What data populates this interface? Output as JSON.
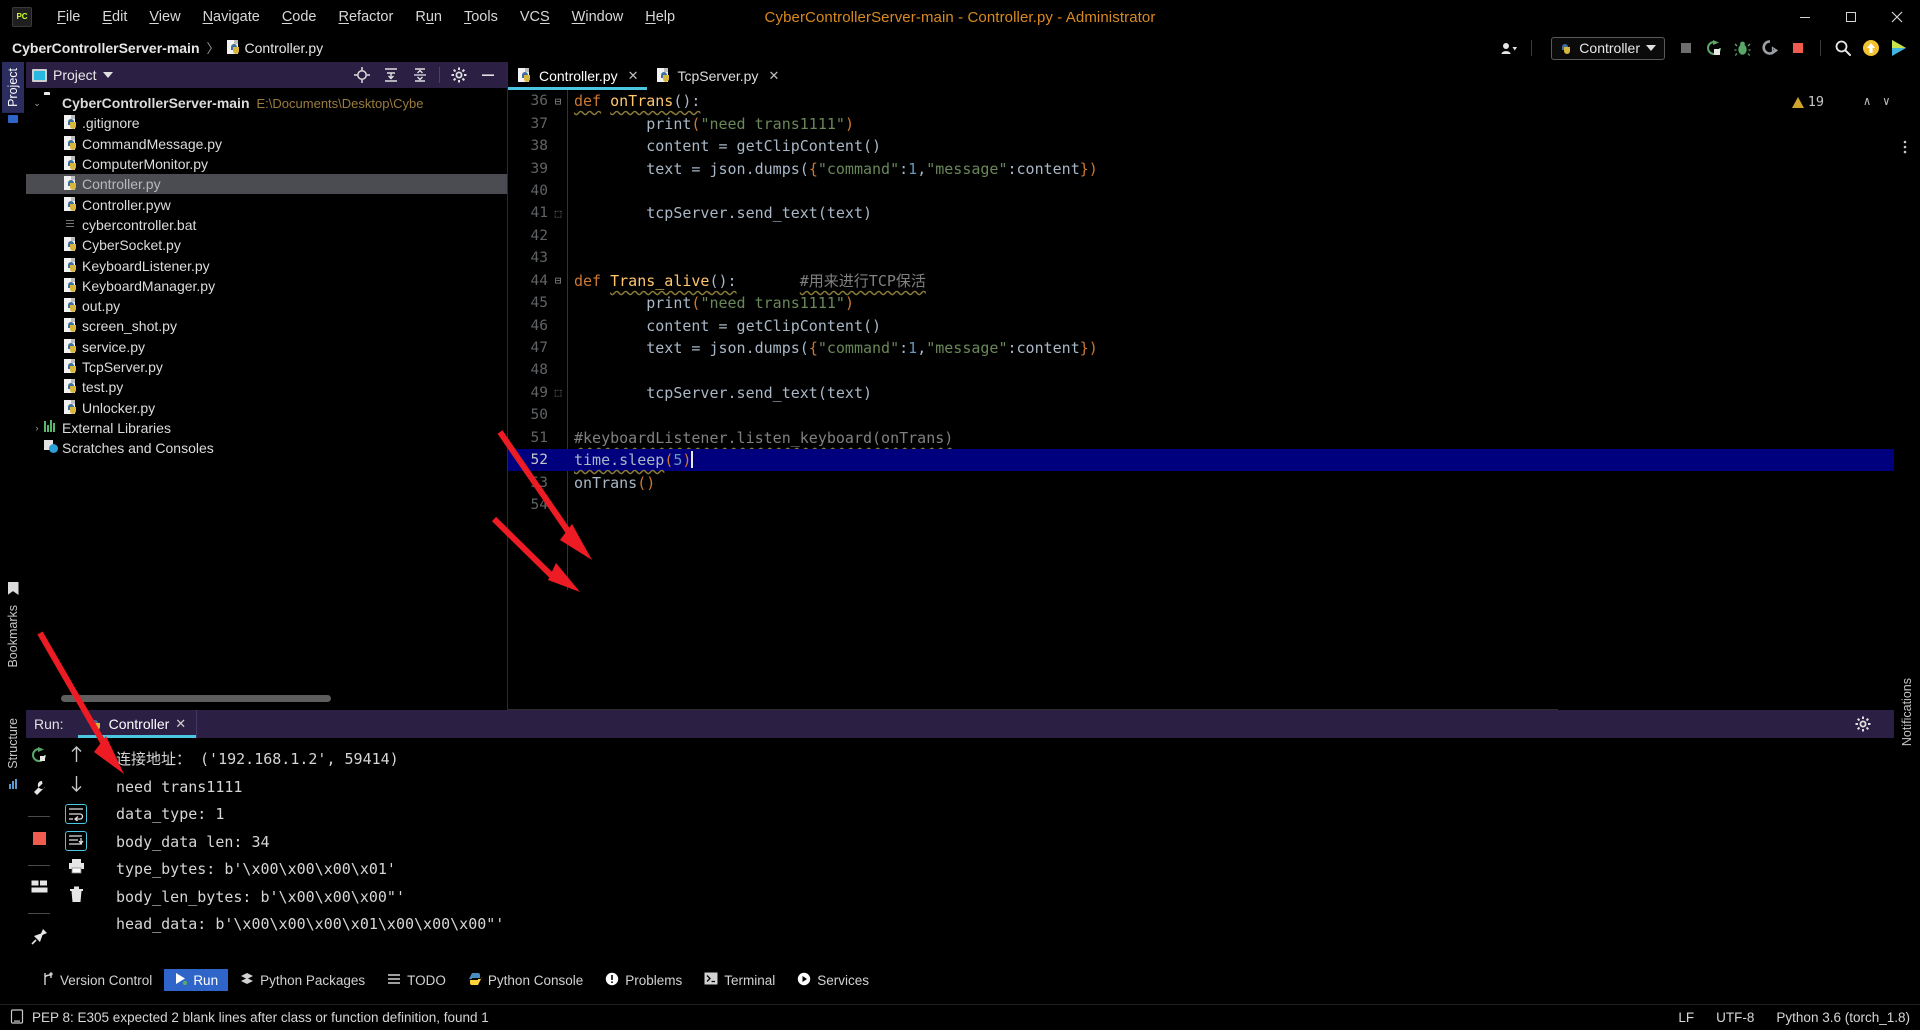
{
  "window": {
    "title": "CyberControllerServer-main - Controller.py - Administrator",
    "logo": "pycharm-logo",
    "minimize": "─",
    "maximize": "❐",
    "close": "✕"
  },
  "menu": [
    {
      "label": "File",
      "mnemonic": "F"
    },
    {
      "label": "Edit",
      "mnemonic": "E"
    },
    {
      "label": "View",
      "mnemonic": "V"
    },
    {
      "label": "Navigate",
      "mnemonic": "N"
    },
    {
      "label": "Code",
      "mnemonic": "C"
    },
    {
      "label": "Refactor",
      "mnemonic": "R"
    },
    {
      "label": "Run",
      "mnemonic": "u"
    },
    {
      "label": "Tools",
      "mnemonic": "T"
    },
    {
      "label": "VCS",
      "mnemonic": "S"
    },
    {
      "label": "Window",
      "mnemonic": "W"
    },
    {
      "label": "Help",
      "mnemonic": "H"
    }
  ],
  "navbar": {
    "breadcrumbs": [
      "CyberControllerServer-main",
      "Controller.py"
    ],
    "separator": "〉",
    "run_config": "Controller",
    "dropdown_caret": "▼",
    "account_caret": "▼"
  },
  "left_strip": [
    {
      "label": "Project",
      "active": true
    },
    {
      "label": "Bookmarks",
      "active": false
    },
    {
      "label": "Structure",
      "active": false
    }
  ],
  "right_strip": [
    {
      "label": "Notifications",
      "active": false
    }
  ],
  "project": {
    "title": "Project",
    "dropdown_caret": "▼",
    "header_icons": [
      "locate-icon",
      "expand-all-icon",
      "collapse-all-icon",
      "gear-icon",
      "hide-icon"
    ],
    "tree": [
      {
        "label": "CyberControllerServer-main",
        "path": "E:\\Documents\\Desktop\\Cybe",
        "icon": "folder-icon",
        "indent": 0,
        "chevron": "⌄",
        "bold": true,
        "selected": false
      },
      {
        "label": ".gitignore",
        "path": "",
        "icon": "python-file-icon",
        "indent": 1,
        "chevron": "",
        "bold": false,
        "selected": false
      },
      {
        "label": "CommandMessage.py",
        "path": "",
        "icon": "python-file-icon",
        "indent": 1,
        "chevron": "",
        "bold": false,
        "selected": false
      },
      {
        "label": "ComputerMonitor.py",
        "path": "",
        "icon": "python-file-icon",
        "indent": 1,
        "chevron": "",
        "bold": false,
        "selected": false
      },
      {
        "label": "Controller.py",
        "path": "",
        "icon": "python-file-icon",
        "indent": 1,
        "chevron": "",
        "bold": false,
        "selected": true
      },
      {
        "label": "Controller.pyw",
        "path": "",
        "icon": "python-file-icon",
        "indent": 1,
        "chevron": "",
        "bold": false,
        "selected": false
      },
      {
        "label": "cybercontroller.bat",
        "path": "",
        "icon": "bat-file-icon",
        "indent": 1,
        "chevron": "",
        "bold": false,
        "selected": false
      },
      {
        "label": "CyberSocket.py",
        "path": "",
        "icon": "python-file-icon",
        "indent": 1,
        "chevron": "",
        "bold": false,
        "selected": false
      },
      {
        "label": "KeyboardListener.py",
        "path": "",
        "icon": "python-file-icon",
        "indent": 1,
        "chevron": "",
        "bold": false,
        "selected": false
      },
      {
        "label": "KeyboardManager.py",
        "path": "",
        "icon": "python-file-icon",
        "indent": 1,
        "chevron": "",
        "bold": false,
        "selected": false
      },
      {
        "label": "out.py",
        "path": "",
        "icon": "python-file-icon",
        "indent": 1,
        "chevron": "",
        "bold": false,
        "selected": false
      },
      {
        "label": "screen_shot.py",
        "path": "",
        "icon": "python-file-icon",
        "indent": 1,
        "chevron": "",
        "bold": false,
        "selected": false
      },
      {
        "label": "service.py",
        "path": "",
        "icon": "python-file-icon",
        "indent": 1,
        "chevron": "",
        "bold": false,
        "selected": false
      },
      {
        "label": "TcpServer.py",
        "path": "",
        "icon": "python-file-icon",
        "indent": 1,
        "chevron": "",
        "bold": false,
        "selected": false
      },
      {
        "label": "test.py",
        "path": "",
        "icon": "python-file-icon",
        "indent": 1,
        "chevron": "",
        "bold": false,
        "selected": false
      },
      {
        "label": "Unlocker.py",
        "path": "",
        "icon": "python-file-icon",
        "indent": 1,
        "chevron": "",
        "bold": false,
        "selected": false
      },
      {
        "label": "External Libraries",
        "path": "",
        "icon": "library-icon",
        "indent": 0,
        "chevron": "›",
        "bold": false,
        "selected": false
      },
      {
        "label": "Scratches and Consoles",
        "path": "",
        "icon": "scratches-icon",
        "indent": 0,
        "chevron": "",
        "bold": false,
        "selected": false
      }
    ]
  },
  "editor": {
    "tabs": [
      {
        "label": "Controller.py",
        "active": true,
        "close": "✕"
      },
      {
        "label": "TcpServer.py",
        "active": false,
        "close": "✕"
      }
    ],
    "more_icon": "⋮",
    "warning_count": "19",
    "nav_up": "∧",
    "nav_down": "∨",
    "first_line_number": 36,
    "lines": [
      {
        "n": 36,
        "fold": "⊟",
        "highlight": false,
        "tokens": [
          {
            "t": "def",
            "c": "kw ul-wave"
          },
          {
            "t": " ",
            "c": "pun"
          },
          {
            "t": "onTrans",
            "c": "fn ul-wave"
          },
          {
            "t": "():",
            "c": "pun ul-wave"
          }
        ]
      },
      {
        "n": 37,
        "fold": "",
        "highlight": false,
        "tokens": [
          {
            "t": "        ",
            "c": "pun"
          },
          {
            "t": "print",
            "c": "def"
          },
          {
            "t": "(",
            "c": "brk"
          },
          {
            "t": "\"need trans1111\"",
            "c": "str"
          },
          {
            "t": ")",
            "c": "brk"
          }
        ]
      },
      {
        "n": 38,
        "fold": "",
        "highlight": false,
        "tokens": [
          {
            "t": "        content = getClipContent()",
            "c": "def"
          }
        ]
      },
      {
        "n": 39,
        "fold": "",
        "highlight": false,
        "tokens": [
          {
            "t": "        text = json.dumps(",
            "c": "def"
          },
          {
            "t": "{",
            "c": "brk"
          },
          {
            "t": "\"command\"",
            "c": "str"
          },
          {
            "t": ":",
            "c": "def"
          },
          {
            "t": "1",
            "c": "num"
          },
          {
            "t": ",",
            "c": "def"
          },
          {
            "t": "\"message\"",
            "c": "str"
          },
          {
            "t": ":",
            "c": "def"
          },
          {
            "t": "content",
            "c": "def"
          },
          {
            "t": "}",
            "c": "brk"
          },
          {
            "t": ")",
            "c": "brk"
          }
        ]
      },
      {
        "n": 40,
        "fold": "",
        "highlight": false,
        "tokens": []
      },
      {
        "n": 41,
        "fold": "⬚",
        "highlight": false,
        "tokens": [
          {
            "t": "        tcpServer.send_text(text)",
            "c": "def"
          }
        ]
      },
      {
        "n": 42,
        "fold": "",
        "highlight": false,
        "tokens": []
      },
      {
        "n": 43,
        "fold": "",
        "highlight": false,
        "tokens": []
      },
      {
        "n": 44,
        "fold": "⊟",
        "highlight": false,
        "tokens": [
          {
            "t": "def",
            "c": "kw"
          },
          {
            "t": " ",
            "c": "pun"
          },
          {
            "t": "Trans_alive",
            "c": "fn ul-wave"
          },
          {
            "t": "():",
            "c": "pun ul-wave"
          },
          {
            "t": "       ",
            "c": "pun"
          },
          {
            "t": "#用来进行TCP保活",
            "c": "cmt ul-wave"
          }
        ]
      },
      {
        "n": 45,
        "fold": "",
        "highlight": false,
        "tokens": [
          {
            "t": "        ",
            "c": "pun"
          },
          {
            "t": "print",
            "c": "def"
          },
          {
            "t": "(",
            "c": "brk"
          },
          {
            "t": "\"need trans1111\"",
            "c": "str"
          },
          {
            "t": ")",
            "c": "brk"
          }
        ]
      },
      {
        "n": 46,
        "fold": "",
        "highlight": false,
        "tokens": [
          {
            "t": "        content = getClipContent()",
            "c": "def"
          }
        ]
      },
      {
        "n": 47,
        "fold": "",
        "highlight": false,
        "tokens": [
          {
            "t": "        text = json.dumps(",
            "c": "def"
          },
          {
            "t": "{",
            "c": "brk"
          },
          {
            "t": "\"command\"",
            "c": "str"
          },
          {
            "t": ":",
            "c": "def"
          },
          {
            "t": "1",
            "c": "num"
          },
          {
            "t": ",",
            "c": "def"
          },
          {
            "t": "\"message\"",
            "c": "str"
          },
          {
            "t": ":",
            "c": "def"
          },
          {
            "t": "content",
            "c": "def"
          },
          {
            "t": "}",
            "c": "brk"
          },
          {
            "t": ")",
            "c": "brk"
          }
        ]
      },
      {
        "n": 48,
        "fold": "",
        "highlight": false,
        "tokens": []
      },
      {
        "n": 49,
        "fold": "⬚",
        "highlight": false,
        "tokens": [
          {
            "t": "        tcpServer.send_text(text)",
            "c": "def"
          }
        ]
      },
      {
        "n": 50,
        "fold": "",
        "highlight": false,
        "tokens": []
      },
      {
        "n": 51,
        "fold": "",
        "highlight": false,
        "tokens": [
          {
            "t": "#keyboardListener.listen_keyboard(onTrans)",
            "c": "cmt ul-wave"
          }
        ]
      },
      {
        "n": 52,
        "fold": "",
        "highlight": true,
        "tokens": [
          {
            "t": "time.sleep",
            "c": "def ul-wave"
          },
          {
            "t": "(",
            "c": "brk"
          },
          {
            "t": "5",
            "c": "num"
          },
          {
            "t": ")",
            "c": "brk"
          }
        ]
      },
      {
        "n": 53,
        "fold": "",
        "highlight": false,
        "tokens": [
          {
            "t": "onTrans",
            "c": "def"
          },
          {
            "t": "()",
            "c": "brk"
          }
        ]
      },
      {
        "n": 54,
        "fold": "",
        "highlight": false,
        "tokens": []
      }
    ]
  },
  "run_panel": {
    "label": "Run:",
    "tab": "Controller",
    "tab_close": "✕",
    "header_icons": [
      "gear-icon",
      "hide-icon"
    ],
    "side_icons": [
      "rerun-icon",
      "wrench-icon",
      "stop-icon",
      "layout-icon",
      "pin-icon"
    ],
    "side_icons2": [
      "up-arrow-icon",
      "down-arrow-icon",
      "soft-wrap-icon",
      "scroll-to-end-icon",
      "print-icon",
      "trash-icon"
    ],
    "console": [
      "连接地址： ('192.168.1.2', 59414)",
      "need trans1111",
      "data_type: 1",
      "body_data len: 34",
      "type_bytes: b'\\x00\\x00\\x00\\x01'",
      "body_len_bytes: b'\\x00\\x00\\x00\"'",
      "head_data: b'\\x00\\x00\\x00\\x01\\x00\\x00\\x00\"'"
    ]
  },
  "bottom_bar": [
    {
      "label": "Version Control",
      "icon": "branch-icon",
      "active": false
    },
    {
      "label": "Run",
      "icon": "play-icon",
      "active": true
    },
    {
      "label": "Python Packages",
      "icon": "packages-icon",
      "active": false
    },
    {
      "label": "TODO",
      "icon": "todo-icon",
      "active": false
    },
    {
      "label": "Python Console",
      "icon": "python-icon",
      "active": false
    },
    {
      "label": "Problems",
      "icon": "problems-icon",
      "active": false
    },
    {
      "label": "Terminal",
      "icon": "terminal-icon",
      "active": false
    },
    {
      "label": "Services",
      "icon": "services-icon",
      "active": false
    }
  ],
  "status_bar": {
    "icon": "inspection-icon",
    "message": "PEP 8: E305 expected 2 blank lines after class or function definition, found 1",
    "line_sep": "LF",
    "encoding": "UTF-8",
    "interpreter": "Python 3.6 (torch_1.8)"
  },
  "toolbar_icons": [
    {
      "name": "build-icon",
      "color": "#6e6e6e"
    },
    {
      "name": "rerun-icon",
      "color": "#59a869"
    },
    {
      "name": "debug-icon",
      "color": "#59a869"
    },
    {
      "name": "coverage-icon",
      "color": "#9aa0a6"
    },
    {
      "name": "stop-icon",
      "color": "#f05b4f"
    },
    {
      "name": "search-icon",
      "color": "#e0e0e0"
    },
    {
      "name": "update-icon",
      "color": "#f2c230"
    },
    {
      "name": "ide-icon",
      "color": "#40b6e0"
    }
  ],
  "colors": {
    "accent": "#4ac6e0",
    "panel_header": "#2b2043",
    "selection": "#00007f",
    "title_text": "#d98a20",
    "active_tab": "#2f65c8",
    "annotation_arrow": "#ed1c24"
  }
}
